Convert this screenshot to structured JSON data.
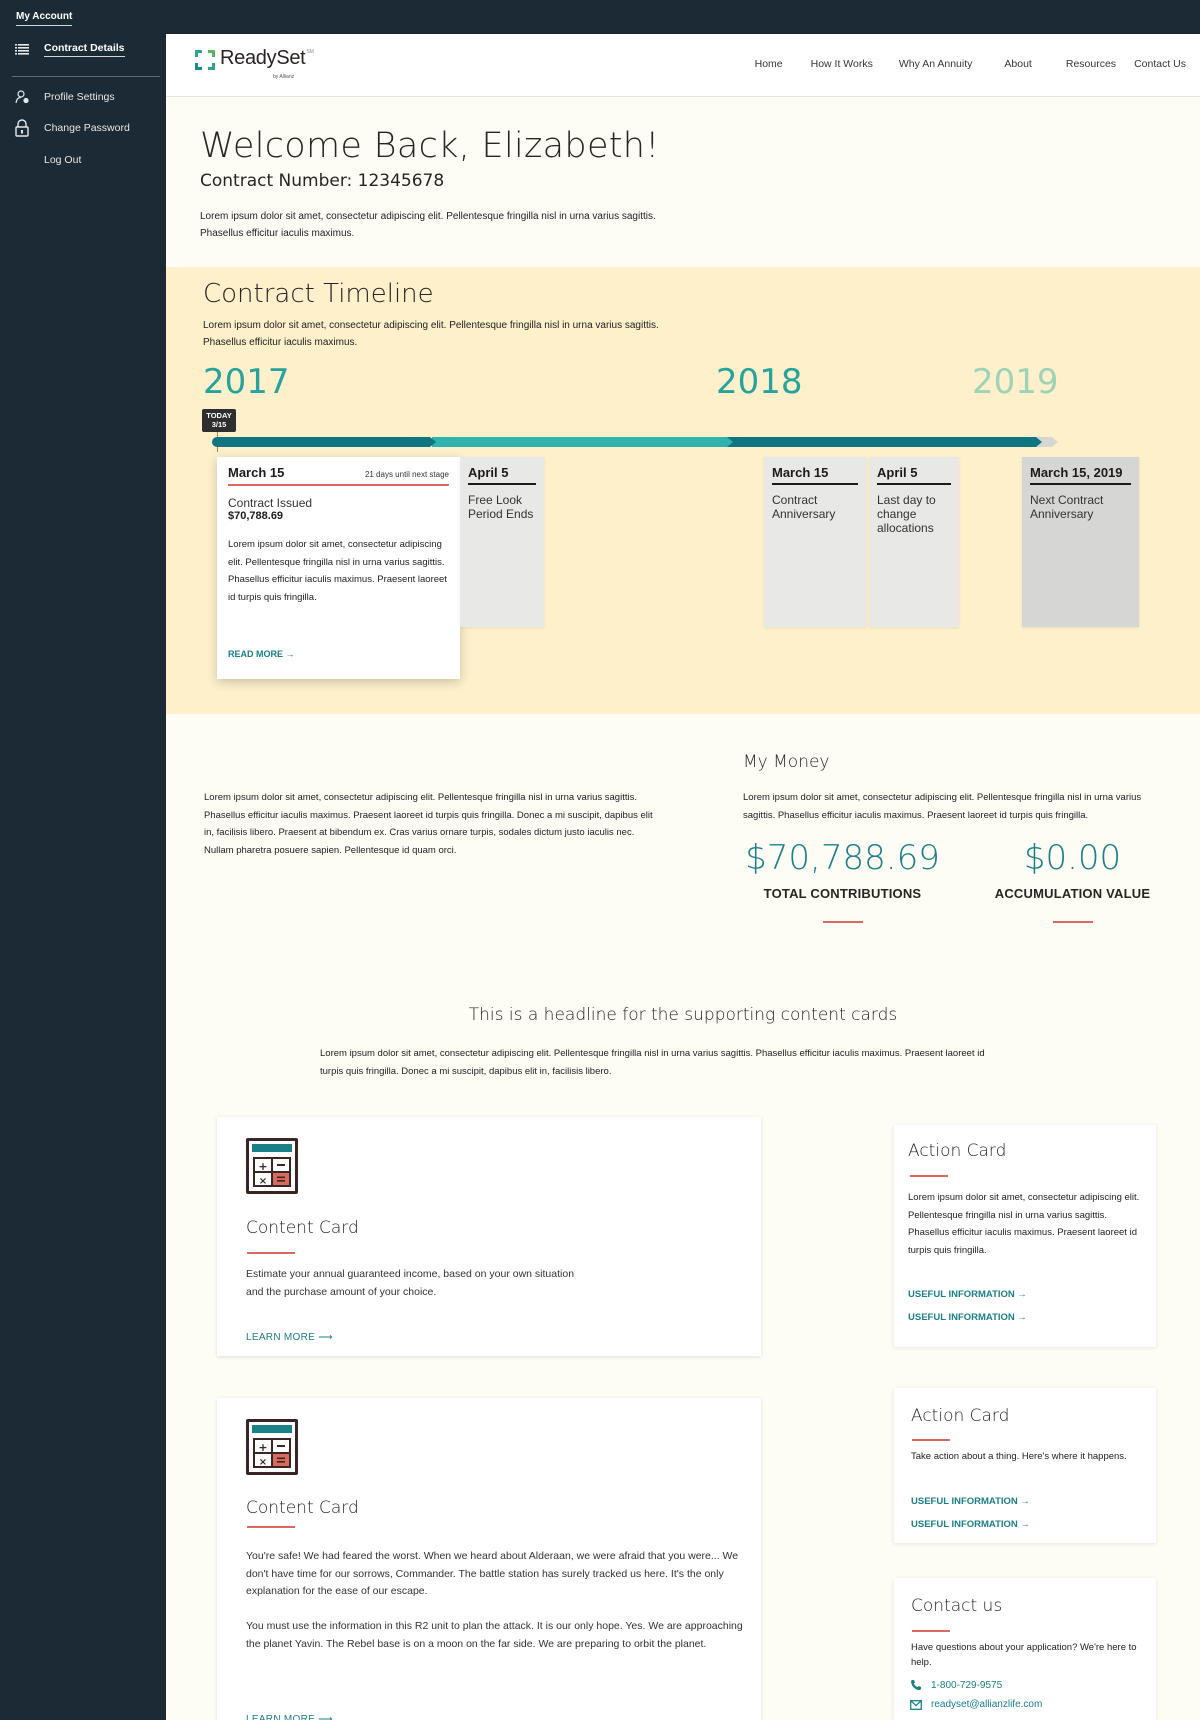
{
  "sidebar": {
    "account_label": "My Account",
    "items": [
      {
        "label": "Contract Details",
        "icon": "list-icon",
        "active": true
      },
      {
        "label": "Profile Settings",
        "icon": "user-settings-icon",
        "active": false
      },
      {
        "label": "Change Password",
        "icon": "lock-icon",
        "active": false
      },
      {
        "label": "Log Out",
        "icon": "",
        "active": false
      }
    ]
  },
  "header": {
    "logo_text": "ReadySet",
    "logo_mark": "SM",
    "logo_sub": "by Allianz",
    "nav": [
      "Home",
      "How It Works",
      "Why An Annuity",
      "About",
      "Resources",
      "Contact Us"
    ]
  },
  "welcome": {
    "title": "Welcome Back, Elizabeth!",
    "contract": "Contract Number: 12345678",
    "text": "Lorem ipsum dolor sit amet, consectetur adipiscing elit. Pellentesque fringilla nisl in urna varius sagittis. Phasellus efficitur iaculis maximus."
  },
  "timeline": {
    "title": "Contract Timeline",
    "text": "Lorem ipsum dolor sit amet, consectetur adipiscing elit. Pellentesque fringilla nisl in urna varius sagittis. Phasellus efficitur iaculis maximus.",
    "years": [
      "2017",
      "2018",
      "2019"
    ],
    "today_label": "TODAY",
    "today_date": "3/15",
    "colors": {
      "dark": "#0f7580",
      "light": "#2fb3ac",
      "future": "#d6d6d4",
      "year_active": "#26a39d",
      "year_future": "#9ed3b7"
    },
    "current": {
      "date": "March 15",
      "countdown": "21 days until next stage",
      "status": "Contract Issued",
      "amount": "$70,788.69",
      "body": "Lorem ipsum dolor sit amet, consectetur adipiscing elit. Pellentesque fringilla nisl in urna varius sagittis. Phasellus efficitur iaculis maximus. Praesent laoreet id turpis quis fringilla.",
      "link": "READ MORE →"
    },
    "milestones": [
      {
        "date": "April 5",
        "desc": "Free Look Period Ends"
      },
      {
        "date": "March 15",
        "desc": "Contract Anniversary"
      },
      {
        "date": "April 5",
        "desc": "Last day to change allocations"
      },
      {
        "date": "March 15, 2019",
        "desc": "Next Contract Anniversary"
      }
    ]
  },
  "money": {
    "left_text": "Lorem ipsum dolor sit amet, consectetur adipiscing elit. Pellentesque fringilla nisl in urna varius sagittis. Phasellus efficitur iaculis maximus. Praesent laoreet id turpis quis fringilla. Donec a mi suscipit, dapibus elit in, facilisis libero. Praesent at bibendum ex. Cras varius ornare turpis, sodales dictum justo iaculis nec. Nullam pharetra posuere sapien. Pellentesque id quam orci.",
    "title": "My Money",
    "text": "Lorem ipsum dolor sit amet, consectetur adipiscing elit. Pellentesque fringilla nisl in urna varius sagittis. Phasellus efficitur iaculis maximus. Praesent laoreet id turpis quis fringilla.",
    "stats": [
      {
        "value": "$70,788.69",
        "label": "TOTAL CONTRIBUTIONS"
      },
      {
        "value": "$0.00",
        "label": "ACCUMULATION VALUE"
      }
    ]
  },
  "supporting": {
    "title": "This is a headline for the supporting content cards",
    "text": "Lorem ipsum dolor sit amet, consectetur adipiscing elit. Pellentesque fringilla nisl in urna varius sagittis. Phasellus efficitur iaculis maximus. Praesent laoreet id turpis quis fringilla. Donec a mi suscipit, dapibus elit in, facilisis libero.",
    "content_cards": [
      {
        "title": "Content Card",
        "icon": "calculator-icon",
        "text": "Estimate your annual guaranteed income, based on your own situation and the purchase amount of your choice.",
        "link": "LEARN MORE"
      },
      {
        "title": "Content Card",
        "icon": "calculator-icon",
        "text": "You're safe! We had feared the worst. When we heard about Alderaan, we were afraid that you were... We don't have time for our sorrows, Commander. The battle station has surely tracked us here. It's the only explanation for the ease of our escape.",
        "text2": "You must use the information in this R2 unit to plan the attack. It is our only hope. Yes. We are approaching the planet Yavin. The Rebel base is on a moon on the far side. We are preparing to orbit the planet.",
        "link": "LEARN MORE"
      }
    ],
    "action_cards": [
      {
        "title": "Action Card",
        "text": "Lorem ipsum dolor sit amet, consectetur adipiscing elit. Pellentesque fringilla nisl in urna varius sagittis. Phasellus efficitur iaculis maximus. Praesent laoreet id turpis quis fringilla.",
        "links": [
          "USEFUL INFORMATION →",
          "USEFUL INFORMATION →"
        ]
      },
      {
        "title": "Action Card",
        "text": "Take action about a thing.  Here's where it happens.",
        "links": [
          "USEFUL INFORMATION →",
          "USEFUL INFORMATION →"
        ]
      }
    ],
    "contact": {
      "title": "Contact us",
      "text": "Have questions about your application? We're here to help.",
      "phone": "1-800-729-9575",
      "email": "readyset@allianzlife.com"
    }
  },
  "colors": {
    "teal": "#1a7f87",
    "coral": "#d86a5f",
    "navy": "#1b2a35",
    "cream": "#fdf0cb"
  }
}
